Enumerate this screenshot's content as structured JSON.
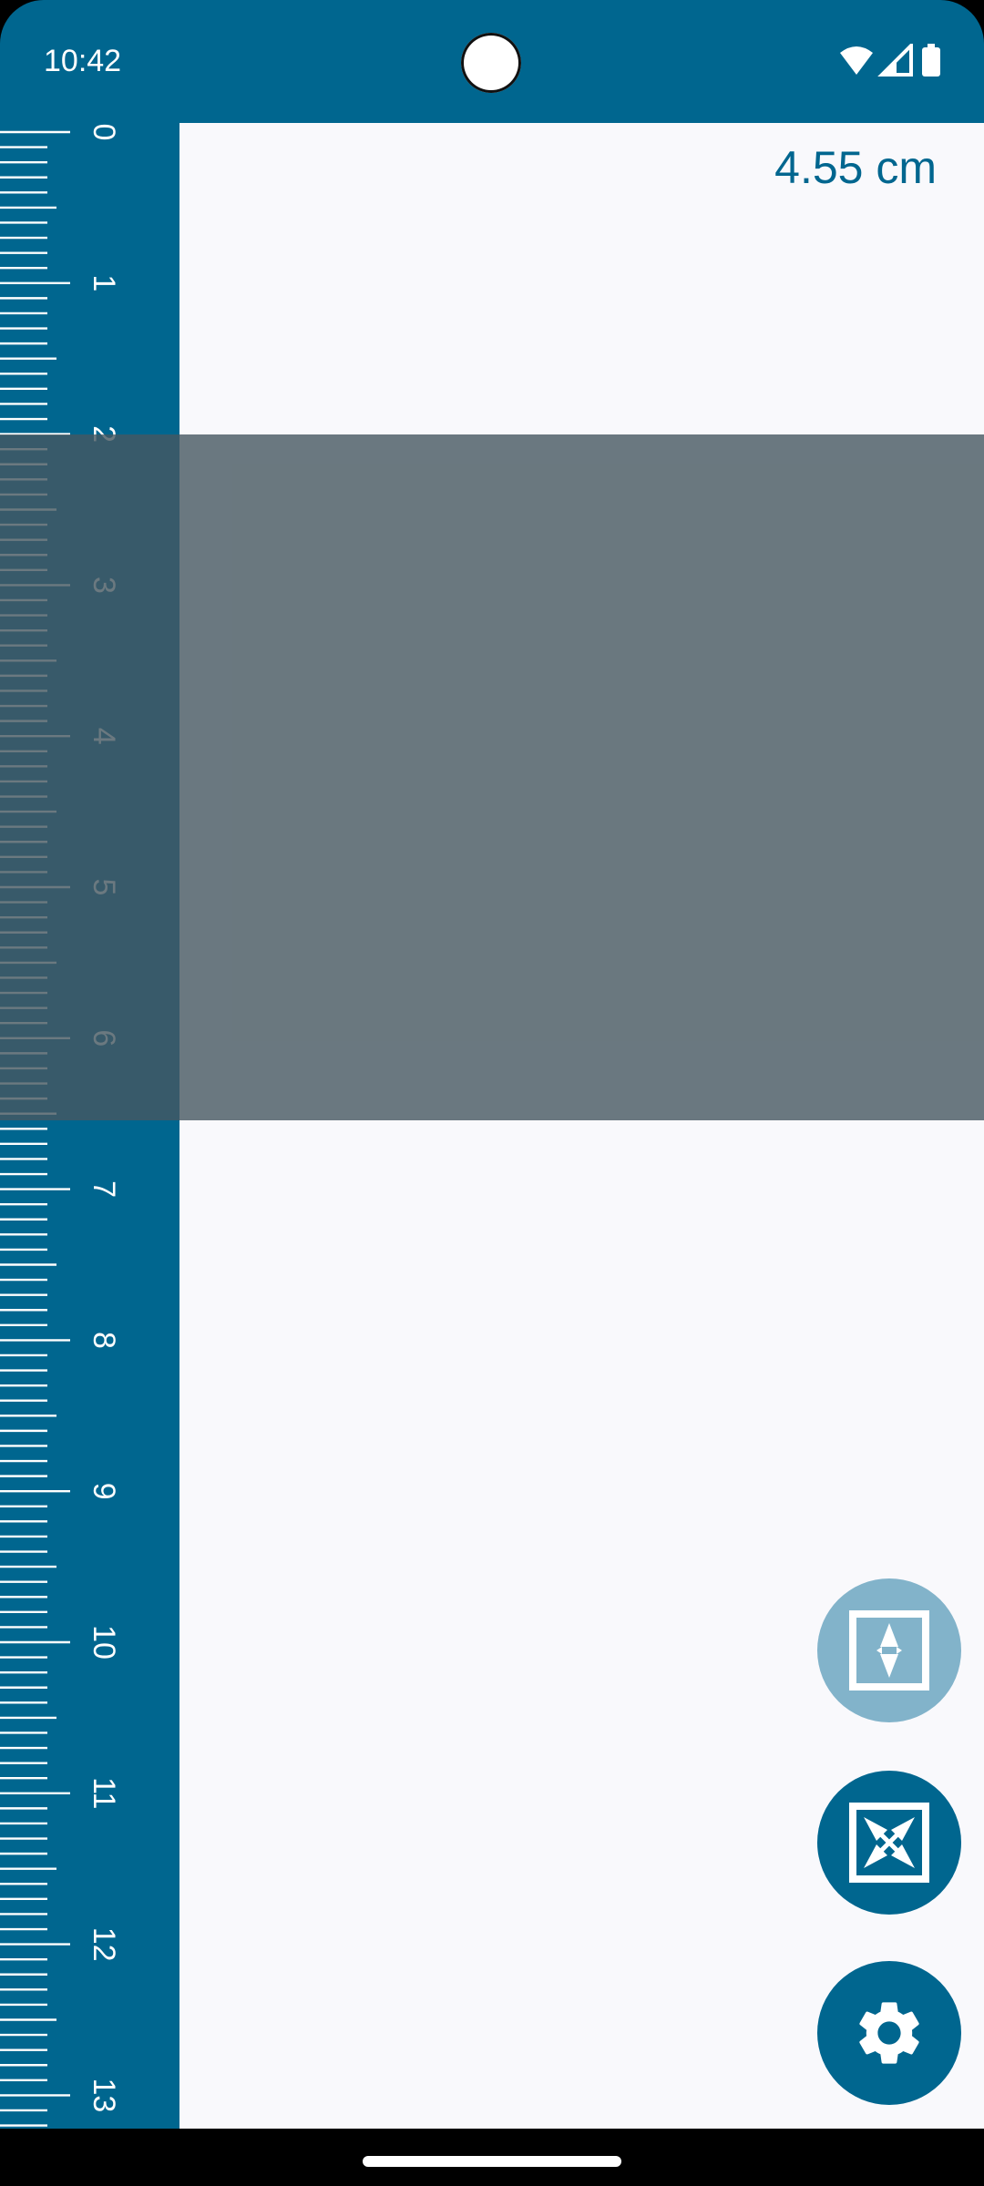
{
  "status_bar": {
    "time": "10:42",
    "icons": [
      "wifi-icon",
      "signal-icon",
      "battery-icon"
    ]
  },
  "ruler": {
    "unit": "cm",
    "labels": [
      "0",
      "1",
      "2",
      "3",
      "4",
      "5",
      "6",
      "7",
      "8",
      "9",
      "10",
      "11",
      "12",
      "13"
    ],
    "color": "#00668F"
  },
  "measurement": {
    "text": "4.55 cm"
  },
  "selection": {
    "start_cm": 2.0,
    "end_cm": 6.55,
    "color": "#465860"
  },
  "buttons": [
    {
      "name": "fit-height-button",
      "icon": "vertical-arrows-icon",
      "state": "disabled"
    },
    {
      "name": "fit-both-button",
      "icon": "diagonal-arrows-icon",
      "state": "enabled"
    },
    {
      "name": "settings-button",
      "icon": "gear-icon",
      "state": "enabled"
    }
  ],
  "colors": {
    "accent": "#00668F",
    "background": "#F9F9FC",
    "disabled_fab": "#82B3CA"
  }
}
